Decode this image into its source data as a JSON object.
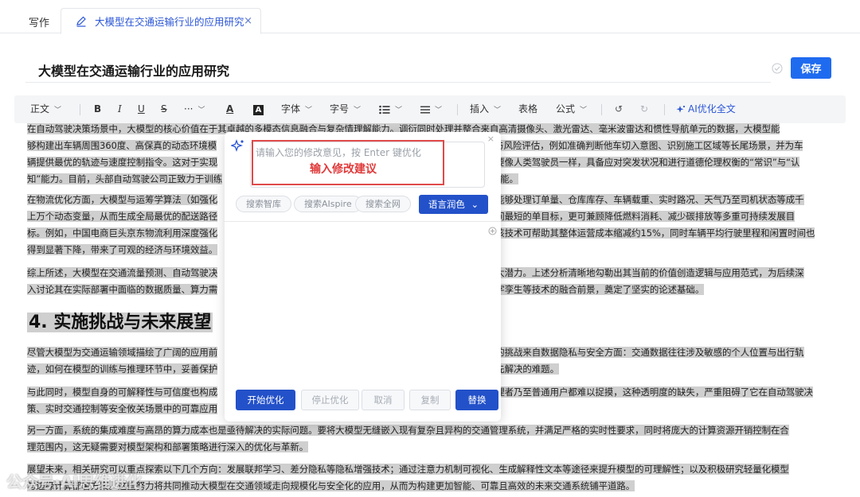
{
  "tabs": {
    "static_label": "写作",
    "active_label": "大模型在交通运输行业的应用研究",
    "close_symbol": "×"
  },
  "document": {
    "title": "大模型在交通运输行业的应用研究",
    "save_label": "保存"
  },
  "toolbar": {
    "paragraph_style": "正文",
    "bold": "B",
    "italic": "I",
    "underline": "U",
    "strike": "S",
    "more": "···",
    "font_color": "A",
    "highlight": "A",
    "font_family": "字体",
    "font_size": "字号",
    "insert": "插入",
    "table": "表格",
    "formula": "公式",
    "undo": "↺",
    "redo": "↻",
    "ai_optimize": "AI优化全文"
  },
  "paragraphs": {
    "p1": [
      "在自动驾驶决策场景中，大模型的核心价值在于其卓越的多模态信息融合与复杂情理解能力。调衍同时处理并整合来自高清摄像头、激光雷达、毫米波雷达和惯性导航单元的数据，大模型能",
      "够构建出车辆周围360度、高保真的动态环境模",
      "与风险评估，例如准确判断他车切入意图、识别施工区域等长尾场景，并为车",
      "辆提供最优的轨迹与速度控制指令。这对于实现",
      "要像人类驾驶员一样，具备应对突发状况和进行道德伦理权衡的“常识”与“认",
      "知”能力。目前，头部自动驾驶公司正致力于训练",
      "能。"
    ],
    "p2": [
      "在物流优化方面，大模型与运筹学算法（如强化",
      "能够处理订单量、仓库库存、车辆载重、实时路况、天气乃至司机状态等成千",
      "上万个动态变量，从而生成全局最优的配送路径",
      "间最短的单目标，更可兼顾降低燃料消耗、减少碳排放等多重可持续发展目",
      "标。例如，中国电商巨头京东物流利用深度强化",
      "该技术可帮助其整体运营成本缩减约15%，同时车辆平均行驶里程和闲置时间也",
      "得到显著下降，带来了可观的经济与环境效益。"
    ],
    "p3": [
      "综上所述，大模型在交通流量预测、自动驾驶决",
      "大潜力。上述分析清晰地勾勒出其当前的价值创造逻辑与应用范式，为后续深",
      "入讨论其在实际部署中面临的数据质量、算力需",
      "字孪生等技术的融合前景，奠定了坚实的论述基础。"
    ],
    "heading": "4. 实施挑战与未来展望",
    "p4": [
      "尽管大模型为交通运输领域描绘了广阔的应用前",
      "的挑战来自数据隐私与安全方面：交通数据往往涉及敏感的个人位置与出行轨",
      "迹，如何在模型的训练与推理环节中，妥善保护",
      "先解决的难题。"
    ],
    "p5": [
      "与此同时，模型自身的可解释性与可信度也构成",
      "理者乃至普通用户都难以捉摸，这种透明度的缺失，严重阻碍了它在自动驾驶决",
      "策、实时交通控制等安全攸关场景中的可靠应用"
    ],
    "p6": [
      "另一方面，系统的集成难度与高昂的算力成本也是亟待解决的实际问题。要将大模型无缝嵌入现有复杂且异构的交通管理系统，并满足严格的实时性要求，同时将庞大的计算资源开销控制在合",
      "理范围内，这无疑需要对模型架构和部署策略进行深入的优化与革新。"
    ],
    "p7": [
      "展望未来，相关研究可以重点探索以下几个方向：发展联邦学习、差分隐私等隐私增强技术；通过注意力机制可视化、生成解释性文本等途径来提升模型的可理解性；以及积极研究轻量化模型",
      "与边缘计算部署方案。这些努力将共同推动大模型在交通领域走向规模化与安全化的应用，从而为构建更加智能、可靠且高效的未来交通系统铺平道路。"
    ]
  },
  "popup": {
    "input_placeholder": "请输入您的修改意见，按 Enter 键优化",
    "annotation": "输入修改建议",
    "pills": [
      "搜索智库",
      "搜索AIspire",
      "搜索全网"
    ],
    "polish_label": "语言润色",
    "polish_caret": "⌄",
    "close_symbol": "×",
    "actions": {
      "start": "开始优化",
      "stop": "停止优化",
      "cancel": "取消",
      "copy": "复制",
      "replace": "替换"
    }
  },
  "watermark": "公众号·AI思维进化",
  "colors": {
    "primary": "#1f6bf0",
    "popup_primary": "#2351c9",
    "annotation_red": "#e04a4a",
    "selection_gray": "#cfcfcf"
  }
}
